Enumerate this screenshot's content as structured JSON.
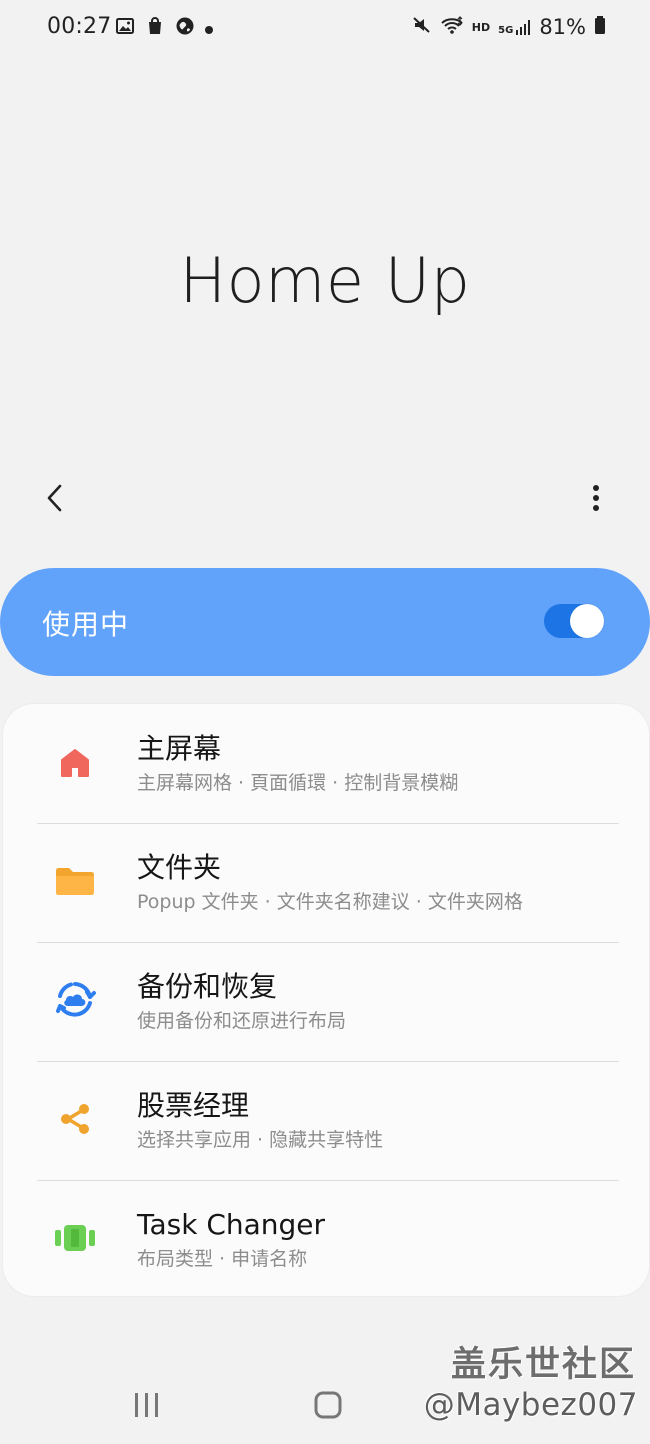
{
  "status_bar": {
    "time": "00:27",
    "left_icons": [
      "image-icon",
      "bag-icon",
      "globe-icon",
      "dot-icon"
    ],
    "right_icons": [
      "mute-icon",
      "wifi-icon",
      "hd-icon",
      "5g-icon",
      "signal-icon",
      "battery-icon"
    ],
    "hd_label": "HD",
    "network_label": "5G",
    "battery": "81%"
  },
  "header": {
    "title": "Home Up",
    "back_icon": "back-icon",
    "more_icon": "more-icon"
  },
  "toggle": {
    "label": "使用中",
    "enabled": true
  },
  "menu": {
    "items": [
      {
        "title": "主屏幕",
        "subtitle": "主屏幕网格 · 頁面循環 · 控制背景模糊",
        "icon": "home-icon",
        "icon_color": "#f0675d"
      },
      {
        "title": "文件夹",
        "subtitle": "Popup 文件夹 · 文件夹名称建议 · 文件夹网格",
        "icon": "folder-icon",
        "icon_color": "#f6a531"
      },
      {
        "title": "备份和恢复",
        "subtitle": "使用备份和还原进行布局",
        "icon": "backup-restore-icon",
        "icon_color": "#2f7ef0"
      },
      {
        "title": "股票经理",
        "subtitle": "选择共享应用 · 隐藏共享特性",
        "icon": "share-icon",
        "icon_color": "#f0a32d"
      },
      {
        "title": "Task Changer",
        "subtitle": "布局类型 · 申请名称",
        "icon": "task-changer-icon",
        "icon_color": "#6bcf53"
      }
    ]
  },
  "watermark": {
    "line1": "盖乐世社区",
    "line2": "@Maybez007"
  },
  "nav": {
    "recents_icon": "recents-icon",
    "home_icon": "home-nav-icon"
  }
}
